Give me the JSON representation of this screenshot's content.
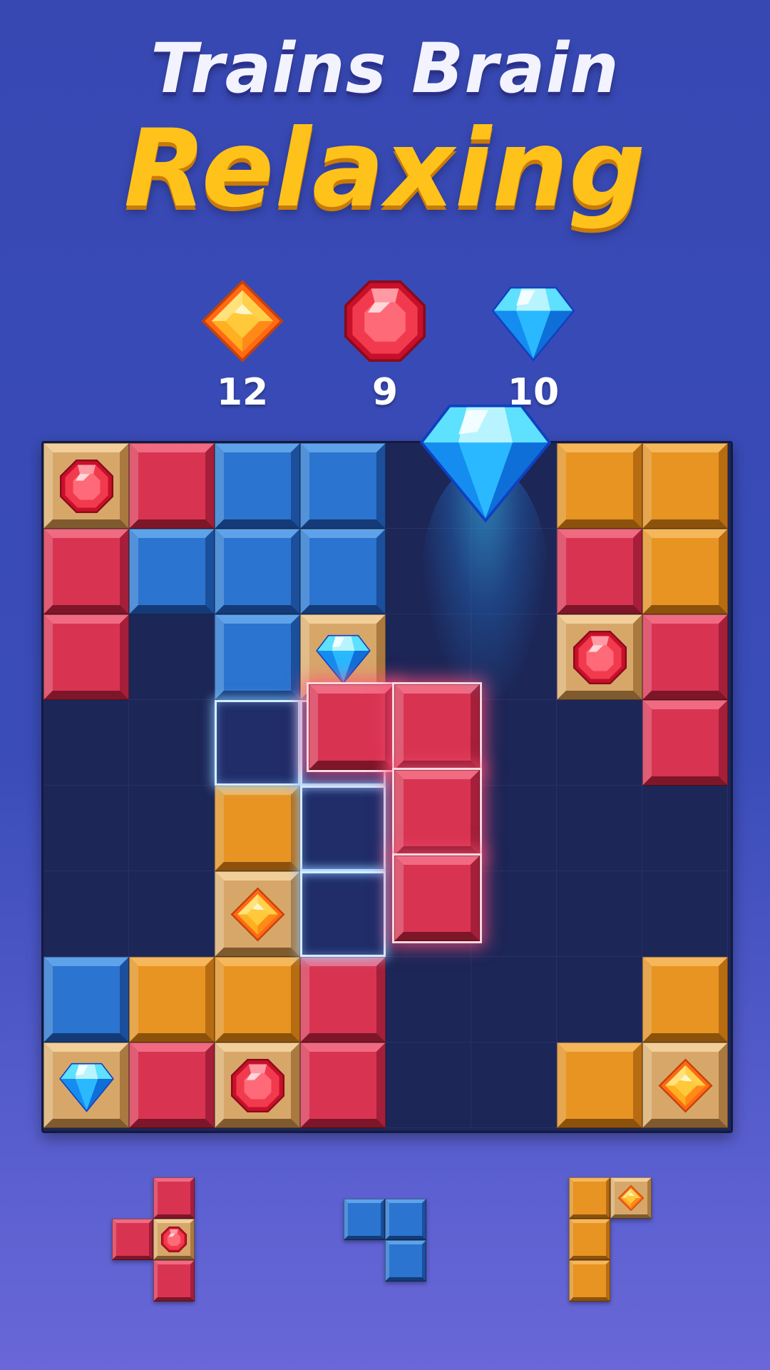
{
  "title": {
    "line1": "Trains Brain",
    "line2": "Relaxing"
  },
  "goals": [
    {
      "gem": "orange-diamond",
      "count": "12"
    },
    {
      "gem": "red-octagon",
      "count": "9"
    },
    {
      "gem": "blue-diamond",
      "count": "10"
    }
  ],
  "colors": {
    "red": "#d83452",
    "blue": "#2b74cf",
    "orange": "#e89422",
    "gemTile": "#d7a76a",
    "board": "#1c2657",
    "titleYellow": "#ffc21a"
  },
  "board": {
    "rows": 8,
    "cols": 8,
    "grid": [
      [
        "G:red",
        "R",
        "B",
        "B",
        "",
        "",
        "O",
        "O"
      ],
      [
        "R",
        "B",
        "B",
        "B",
        "",
        "",
        "R",
        "O"
      ],
      [
        "R",
        "",
        "B",
        "G:blue",
        "",
        "",
        "G:red",
        "R"
      ],
      [
        "",
        "",
        "",
        "",
        "",
        "",
        "",
        "R"
      ],
      [
        "",
        "",
        "O",
        "",
        "",
        "",
        "",
        ""
      ],
      [
        "",
        "",
        "G:orange",
        "",
        "",
        "",
        "",
        ""
      ],
      [
        "B",
        "O",
        "O",
        "R",
        "",
        "",
        "",
        "O"
      ],
      [
        "G:blue",
        "R",
        "G:red",
        "R",
        "",
        "",
        "O",
        "G:orange"
      ]
    ],
    "hint_cells": [
      [
        3,
        2
      ],
      [
        3,
        3
      ],
      [
        4,
        3
      ],
      [
        5,
        3
      ]
    ],
    "dragging_piece": {
      "color": "R",
      "cells": [
        [
          3,
          3
        ],
        [
          3,
          4
        ],
        [
          4,
          4
        ],
        [
          5,
          4
        ]
      ]
    },
    "collected_gem": "blue-diamond"
  },
  "tray": [
    {
      "name": "tray-piece-red",
      "cells": [
        [
          0,
          1,
          "R"
        ],
        [
          1,
          0,
          "R"
        ],
        [
          1,
          1,
          "G:red"
        ],
        [
          2,
          1,
          "R"
        ]
      ]
    },
    {
      "name": "tray-piece-blue",
      "cells": [
        [
          0,
          0,
          "B"
        ],
        [
          0,
          1,
          "B"
        ],
        [
          1,
          1,
          "B"
        ]
      ]
    },
    {
      "name": "tray-piece-orange",
      "cells": [
        [
          0,
          0,
          "O"
        ],
        [
          0,
          1,
          "G:orange"
        ],
        [
          1,
          0,
          "O"
        ],
        [
          2,
          0,
          "O"
        ]
      ]
    }
  ]
}
